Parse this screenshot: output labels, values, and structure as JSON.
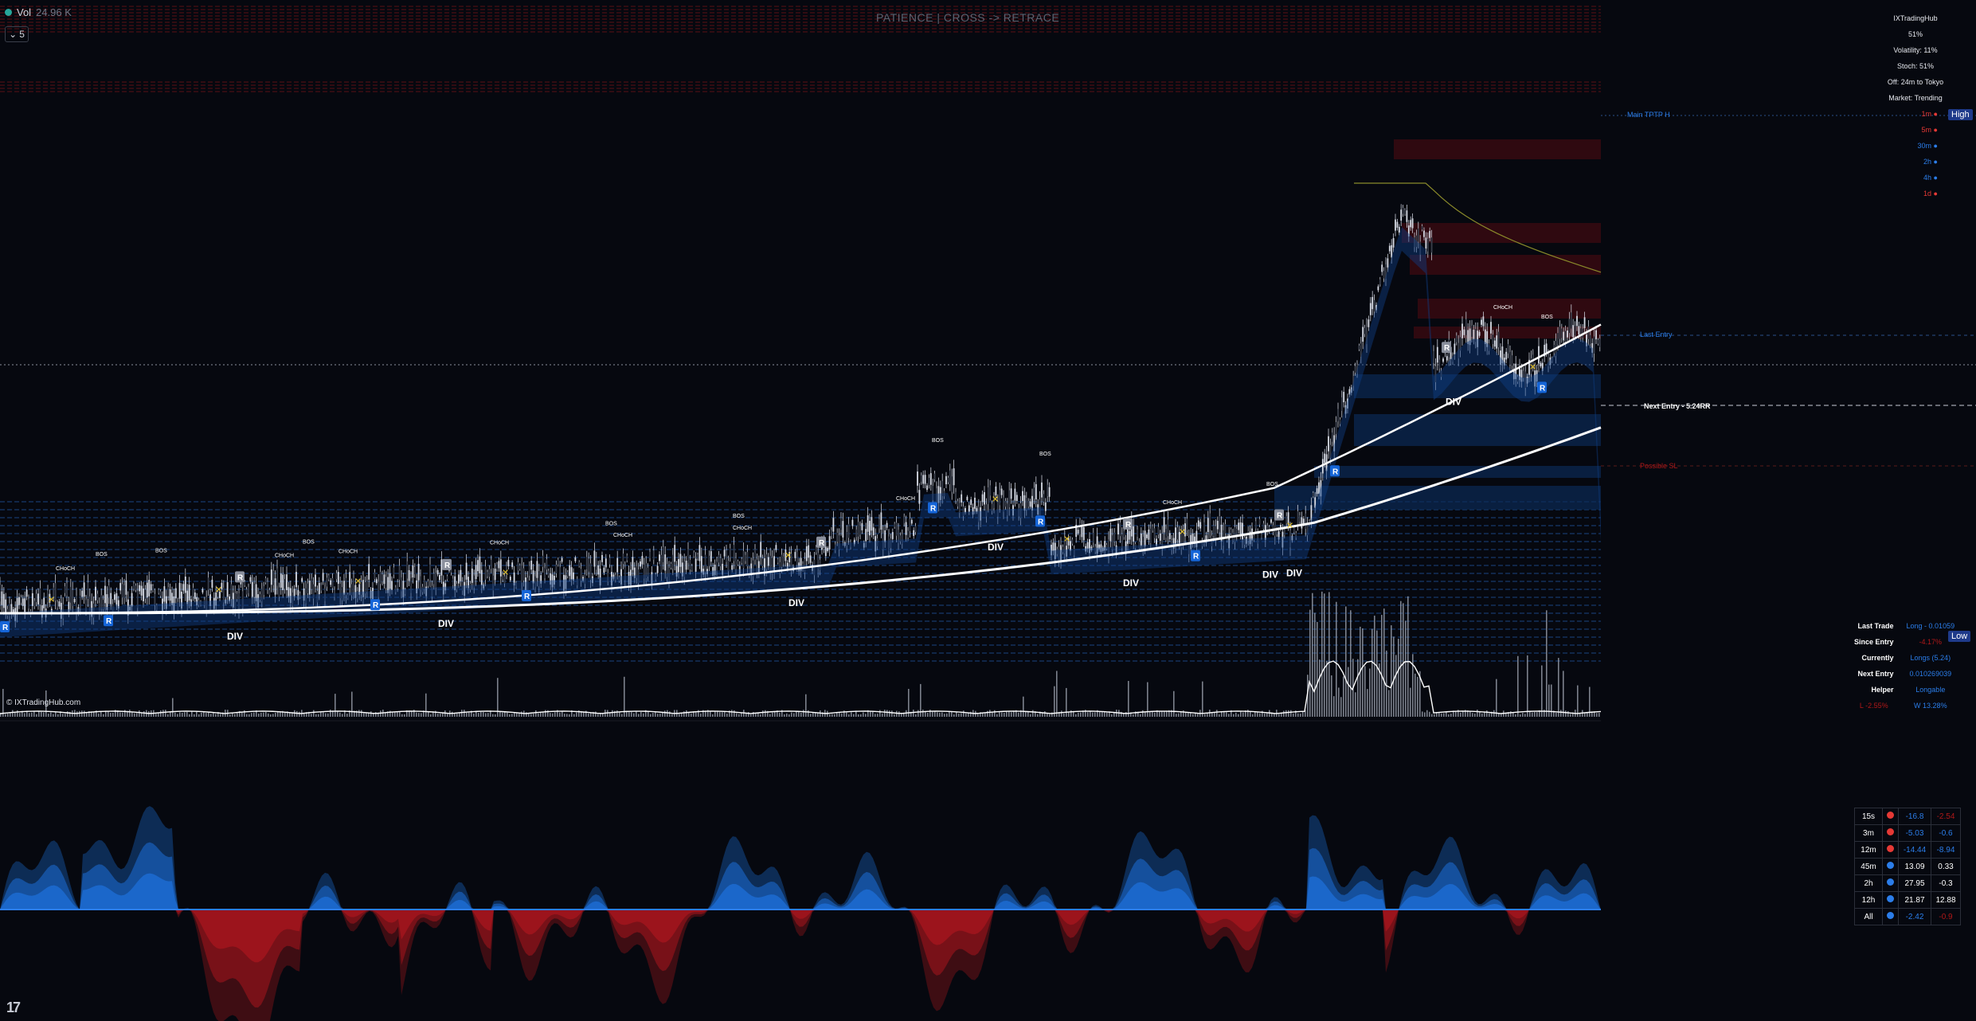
{
  "header": {
    "volume_label": "Vol",
    "volume_value": "24.96 K",
    "interval": "5",
    "banner": "PATIENCE | CROSS -> RETRACE"
  },
  "colors": {
    "bull": "#2b7de9",
    "bear": "#b01818",
    "background": "#06080f",
    "text": "#d1d4dc"
  },
  "info_panel": {
    "brand": "IXTradingHub",
    "pct": "51%",
    "volatility": "Volatility: 11%",
    "stoch": "Stoch: 51%",
    "session": "Off: 24m to Tokyo",
    "market": "Market: Trending"
  },
  "timeframes": [
    {
      "label": "1m ●",
      "color": "#e53935"
    },
    {
      "label": "5m ●",
      "color": "#e53935"
    },
    {
      "label": "30m ●",
      "color": "#2b7de9"
    },
    {
      "label": "2h ●",
      "color": "#2b7de9"
    },
    {
      "label": "4h ●",
      "color": "#2b7de9"
    },
    {
      "label": "1d ●",
      "color": "#e53935"
    }
  ],
  "badges": {
    "high": "High",
    "low": "Low"
  },
  "levels": {
    "main_tptp": "Main TPTP H",
    "last_entry": "Last Entry",
    "next_entry": "Next Entry - 5.24RR",
    "possible_sl": "Possible SL"
  },
  "chart_annotations": {
    "bos": "BOS",
    "choch": "CHoCH",
    "div": "DIV",
    "r": "R"
  },
  "trade_info": {
    "rows": [
      {
        "label": "Last Trade",
        "value": "Long - 0.01059",
        "color": "#2b7de9"
      },
      {
        "label": "Since Entry",
        "value": "-4.17%",
        "color": "#b01818"
      },
      {
        "label": "Currently",
        "value": "Longs (5.24)",
        "color": "#2b7de9"
      },
      {
        "label": "Next Entry",
        "value": "0.010269039",
        "color": "#2b7de9"
      },
      {
        "label": "Helper",
        "value": "Longable",
        "color": "#2b7de9"
      }
    ],
    "footer_left": "L -2.55%",
    "footer_right": "W 13.28%"
  },
  "mtf_table": [
    {
      "tf": "15s",
      "dot": "#e53935",
      "value": "-16.8",
      "change": "-2.54",
      "change_color": "#b01818"
    },
    {
      "tf": "3m",
      "dot": "#e53935",
      "value": "-5.03",
      "change": "-0.6",
      "change_color": "#2b7de9"
    },
    {
      "tf": "12m",
      "dot": "#e53935",
      "value": "-14.44",
      "change": "-8.94",
      "change_color": "#2b7de9"
    },
    {
      "tf": "45m",
      "dot": "#2b7de9",
      "value": "13.09",
      "change": "0.33",
      "change_color": "#ffffff"
    },
    {
      "tf": "2h",
      "dot": "#2b7de9",
      "value": "27.95",
      "change": "-0.3",
      "change_color": "#ffffff"
    },
    {
      "tf": "12h",
      "dot": "#2b7de9",
      "value": "21.87",
      "change": "12.88",
      "change_color": "#ffffff"
    },
    {
      "tf": "All",
      "dot": "#2b7de9",
      "value": "-2.42",
      "change": "-0.9",
      "change_color": "#b01818"
    }
  ],
  "watermark": "© IXTradingHub.com",
  "logo": "17"
}
